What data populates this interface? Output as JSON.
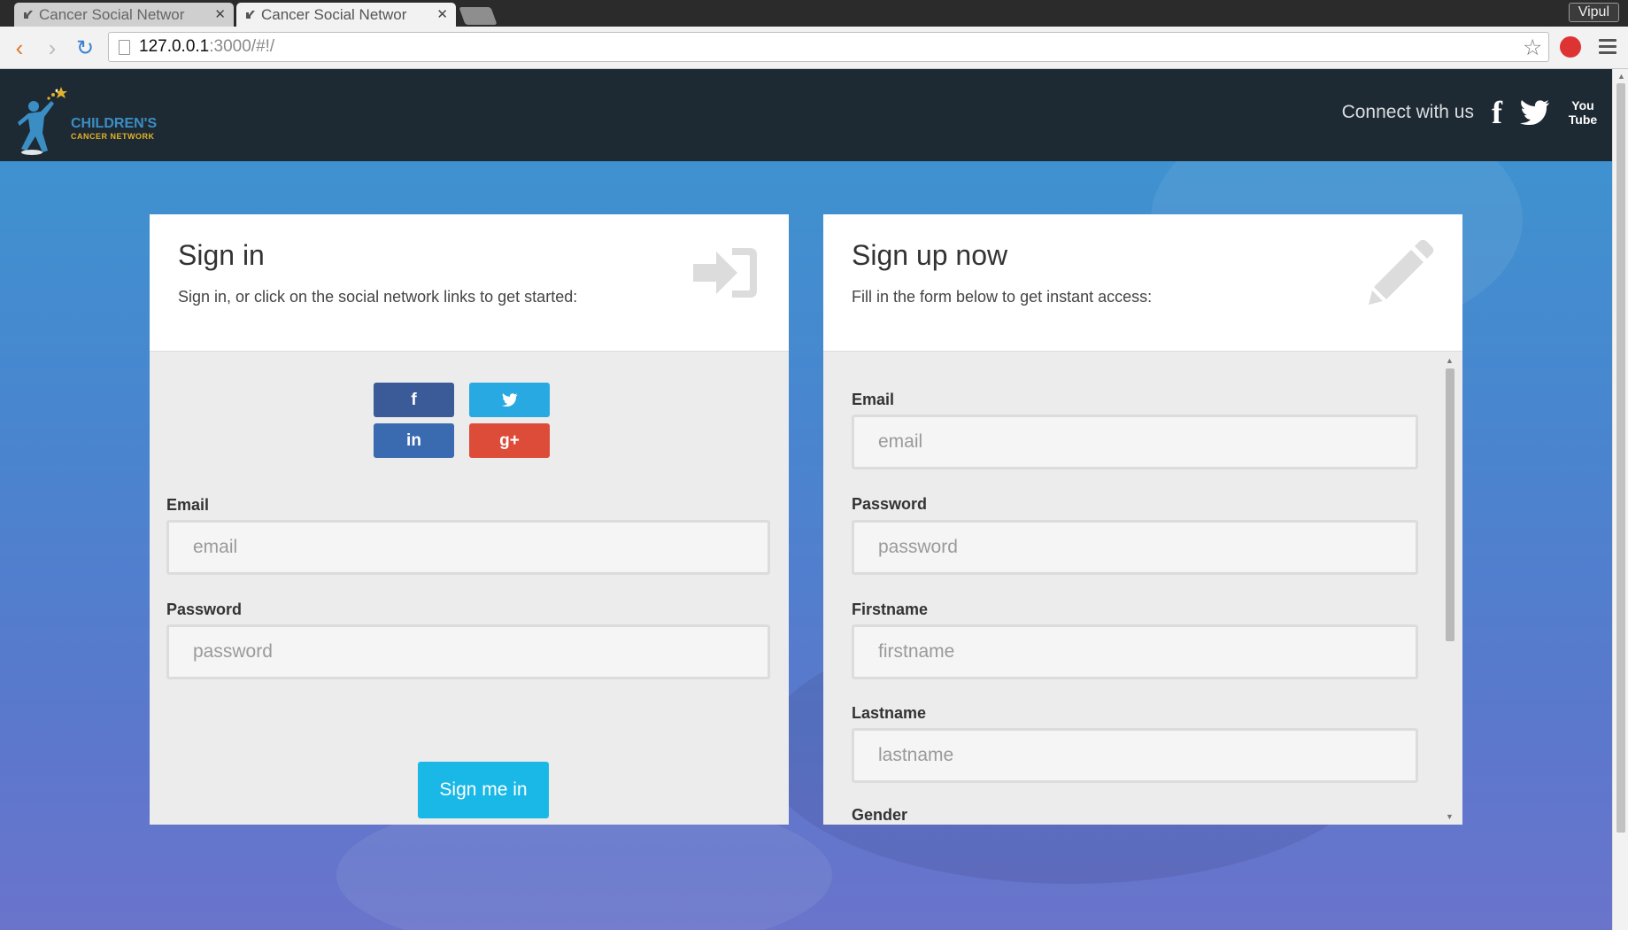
{
  "browser": {
    "tabs": [
      {
        "title": "Cancer Social Networ",
        "active": false
      },
      {
        "title": "Cancer Social Networ",
        "active": true
      }
    ],
    "profile": "Vipul",
    "url_host": "127.0.0.1",
    "url_rest": ":3000/#!/"
  },
  "header": {
    "logo_line1": "CHILDREN'S",
    "logo_line2": "CANCER NETWORK",
    "connect_label": "Connect with us",
    "social_icons": [
      "facebook-icon",
      "twitter-icon",
      "youtube-icon"
    ],
    "youtube_label": "You Tube"
  },
  "signin": {
    "title": "Sign in",
    "subtitle": "Sign in, or click on the social network links to get started:",
    "email_label": "Email",
    "email_placeholder": "email",
    "password_label": "Password",
    "password_placeholder": "password",
    "submit_label": "Sign me in",
    "social_buttons": {
      "facebook": "f",
      "twitter": "twitter-bird",
      "linkedin": "in",
      "googleplus": "g+"
    }
  },
  "signup": {
    "title": "Sign up now",
    "subtitle": "Fill in the form below to get instant access:",
    "email_label": "Email",
    "email_placeholder": "email",
    "password_label": "Password",
    "password_placeholder": "password",
    "firstname_label": "Firstname",
    "firstname_placeholder": "firstname",
    "lastname_label": "Lastname",
    "lastname_placeholder": "lastname",
    "gender_label": "Gender"
  },
  "colors": {
    "header_bg": "#1e2a33",
    "facebook": "#3b5a98",
    "twitter": "#29a9e1",
    "linkedin": "#3a6aaf",
    "googleplus": "#dd4b39",
    "signin_button": "#19b8e6"
  }
}
